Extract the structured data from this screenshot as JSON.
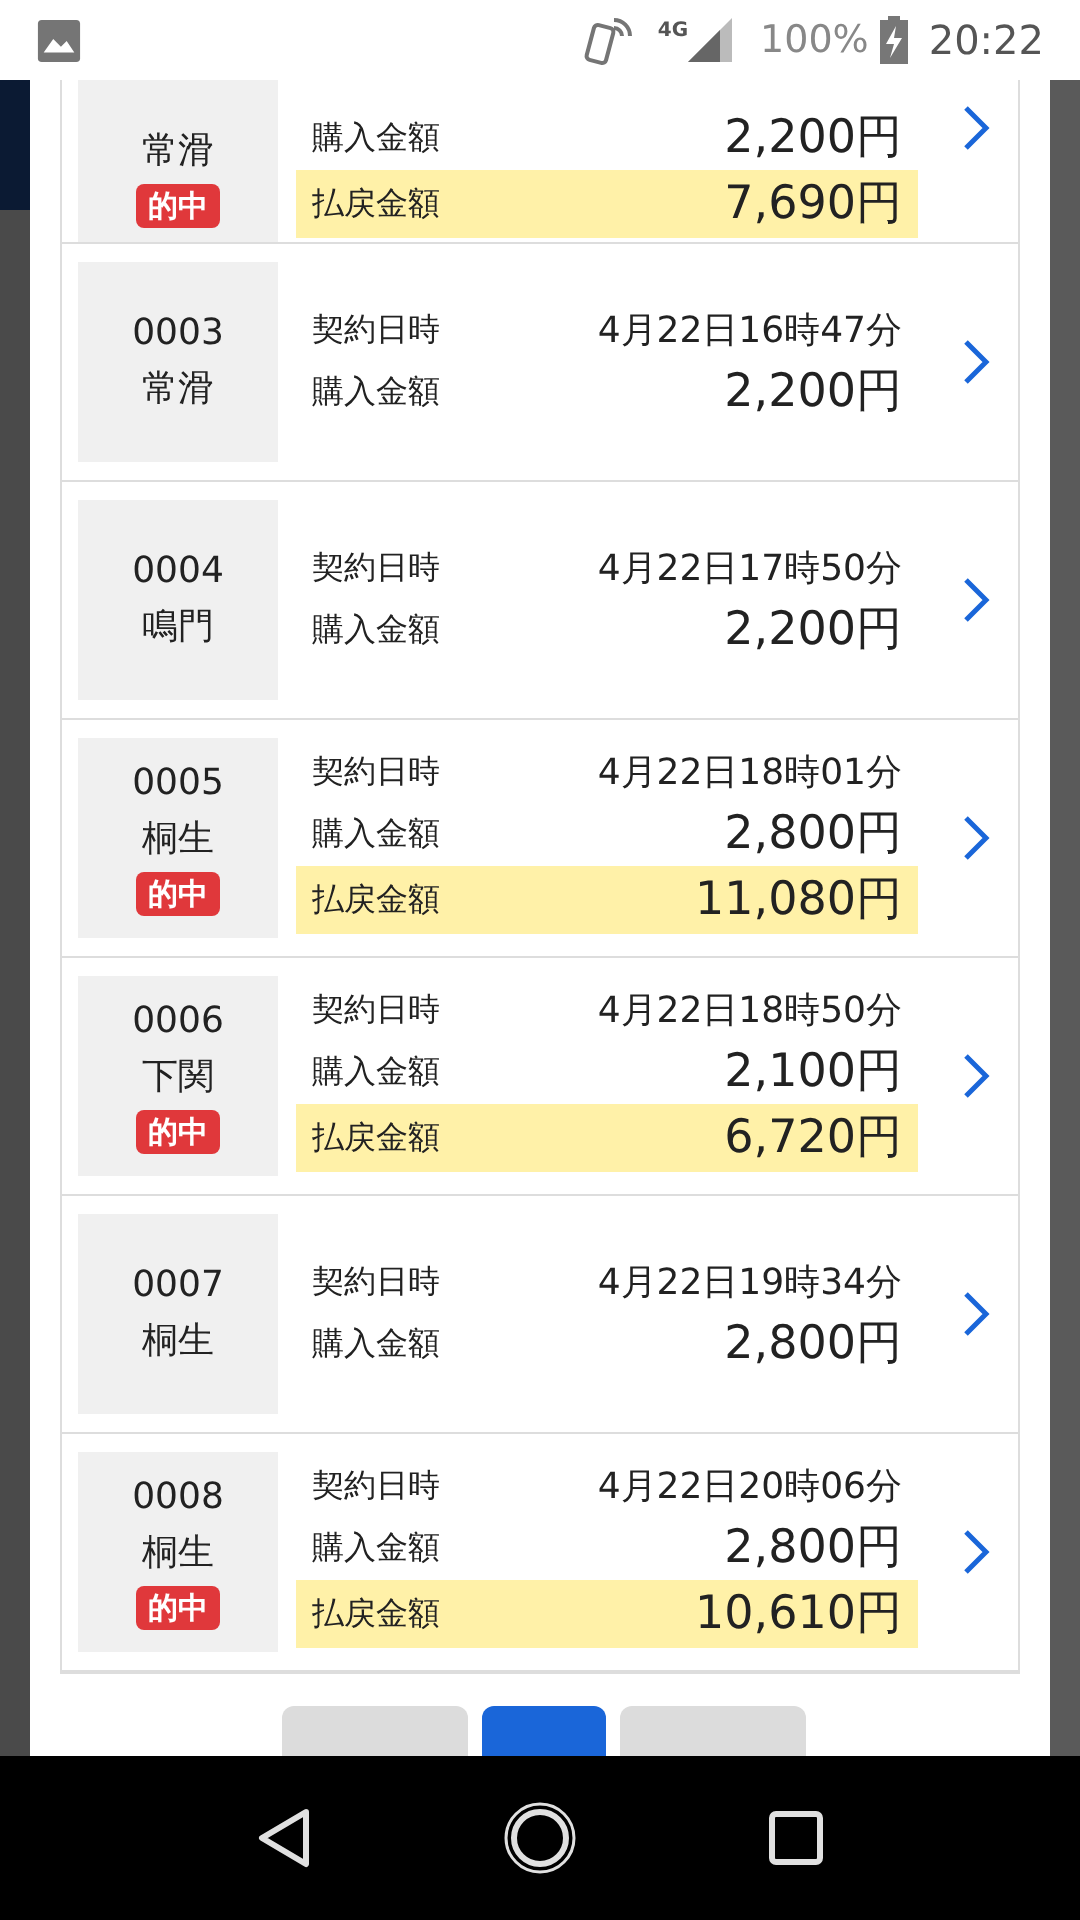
{
  "status_bar": {
    "network": "4G",
    "battery": "100%",
    "time": "20:22"
  },
  "bets": [
    {
      "venue": "常滑",
      "hit": true,
      "hit_label": "的中",
      "purchase_label": "購入金額",
      "purchase": "2,200円",
      "payout_label": "払戻金額",
      "payout": "7,690円"
    },
    {
      "code": "0003",
      "venue": "常滑",
      "hit": false,
      "date_label": "契約日時",
      "date": "4月22日16時47分",
      "purchase_label": "購入金額",
      "purchase": "2,200円"
    },
    {
      "code": "0004",
      "venue": "鳴門",
      "hit": false,
      "date_label": "契約日時",
      "date": "4月22日17時50分",
      "purchase_label": "購入金額",
      "purchase": "2,200円"
    },
    {
      "code": "0005",
      "venue": "桐生",
      "hit": true,
      "hit_label": "的中",
      "date_label": "契約日時",
      "date": "4月22日18時01分",
      "purchase_label": "購入金額",
      "purchase": "2,800円",
      "payout_label": "払戻金額",
      "payout": "11,080円"
    },
    {
      "code": "0006",
      "venue": "下関",
      "hit": true,
      "hit_label": "的中",
      "date_label": "契約日時",
      "date": "4月22日18時50分",
      "purchase_label": "購入金額",
      "purchase": "2,100円",
      "payout_label": "払戻金額",
      "payout": "6,720円"
    },
    {
      "code": "0007",
      "venue": "桐生",
      "hit": false,
      "date_label": "契約日時",
      "date": "4月22日19時34分",
      "purchase_label": "購入金額",
      "purchase": "2,800円"
    },
    {
      "code": "0008",
      "venue": "桐生",
      "hit": true,
      "hit_label": "的中",
      "date_label": "契約日時",
      "date": "4月22日20時06分",
      "purchase_label": "購入金額",
      "purchase": "2,800円",
      "payout_label": "払戻金額",
      "payout": "10,610円"
    }
  ],
  "pagination": [
    {
      "selected": false
    },
    {
      "selected": true
    },
    {
      "selected": false
    }
  ]
}
